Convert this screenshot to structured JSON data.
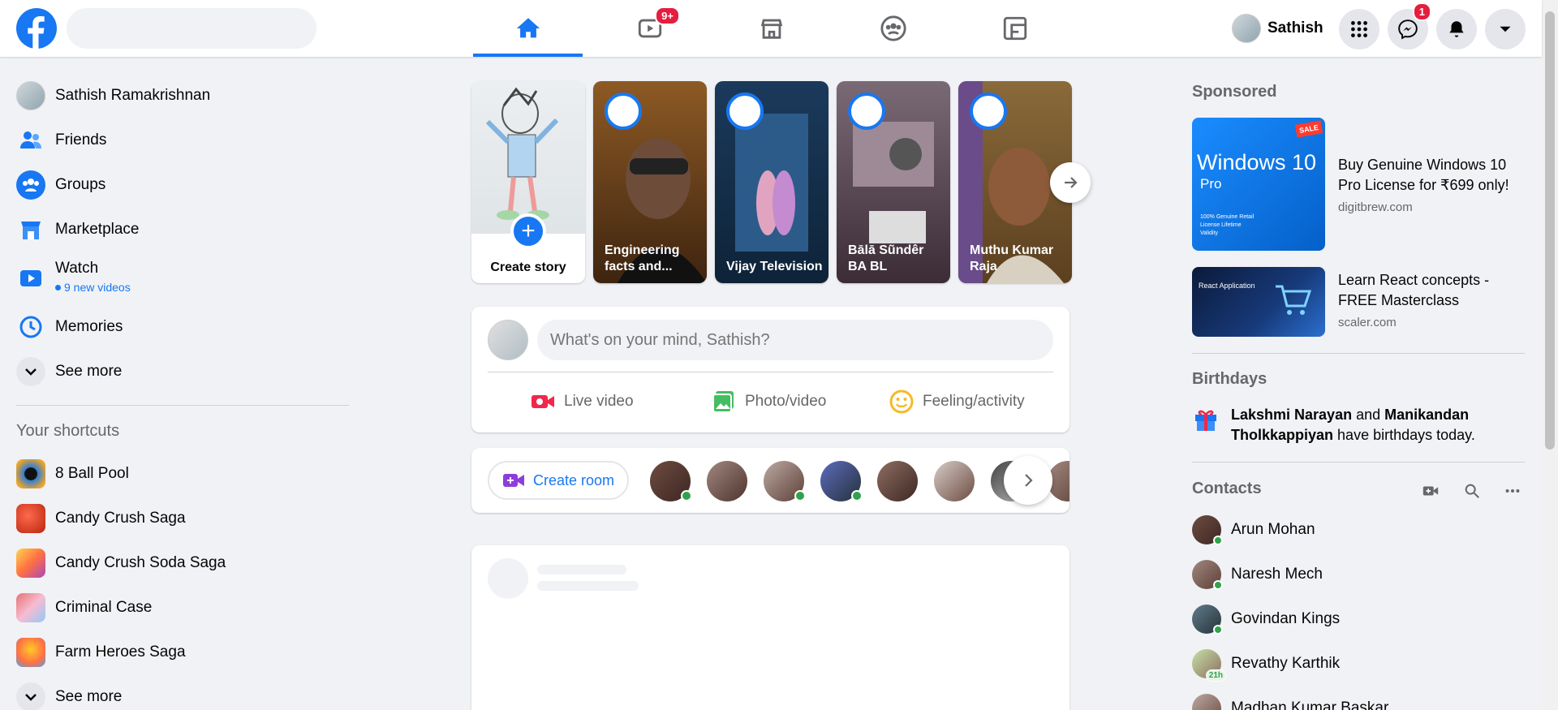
{
  "header": {
    "search_placeholder": "",
    "video_badge": "9+",
    "profile_name": "Sathish",
    "messenger_badge": "1"
  },
  "left": {
    "profile_name": "Sathish Ramakrishnan",
    "items": [
      {
        "label": "Friends"
      },
      {
        "label": "Groups"
      },
      {
        "label": "Marketplace"
      },
      {
        "label": "Watch",
        "sub": "9 new videos"
      },
      {
        "label": "Memories"
      },
      {
        "label": "See more"
      }
    ],
    "shortcuts_title": "Your shortcuts",
    "shortcuts": [
      {
        "label": "8 Ball Pool"
      },
      {
        "label": "Candy Crush Saga"
      },
      {
        "label": "Candy Crush Soda Saga"
      },
      {
        "label": "Criminal Case"
      },
      {
        "label": "Farm Heroes Saga"
      }
    ],
    "shortcuts_see_more": "See more"
  },
  "stories": {
    "create_label": "Create story",
    "items": [
      {
        "label": "Engineering facts and...",
        "color": "#7a4a1a"
      },
      {
        "label": "Vijay Television",
        "color": "#1b3a5c"
      },
      {
        "label": "Bālā Sũndêr BA BL",
        "color": "#5a3a4a"
      },
      {
        "label": "Muthu Kumar Raja",
        "color": "#6b5a2a"
      }
    ]
  },
  "composer": {
    "placeholder": "What's on your mind, Sathish?",
    "live_video": "Live video",
    "photo_video": "Photo/video",
    "feeling": "Feeling/activity"
  },
  "rooms": {
    "create_room": "Create room"
  },
  "right": {
    "sponsored_title": "Sponsored",
    "ads": [
      {
        "image_title": "Windows 10",
        "image_sub": "Pro",
        "image_note": "100% Genuine Retail License Lifetime Validity",
        "image_badge": "SALE",
        "title": "Buy Genuine Windows 10 Pro License for ₹699 only!",
        "domain": "digitbrew.com"
      },
      {
        "image_title": "React Application",
        "title": "Learn React concepts - FREE Masterclass",
        "domain": "scaler.com"
      }
    ],
    "birthdays_title": "Birthdays",
    "birthday_name1": "Lakshmi Narayan",
    "birthday_and": "and",
    "birthday_name2": "Manikandan Tholkkappiyan",
    "birthday_suffix": "have birthdays today.",
    "contacts_title": "Contacts",
    "contacts": [
      {
        "name": "Arun Mohan"
      },
      {
        "name": "Naresh Mech"
      },
      {
        "name": "Govindan Kings"
      },
      {
        "name": "Revathy Karthik",
        "badge": "21h"
      },
      {
        "name": "Madhan Kumar Baskar"
      }
    ]
  },
  "colors": {
    "brand": "#1877f2",
    "online": "#31a24c",
    "badge": "#e41e3f"
  }
}
